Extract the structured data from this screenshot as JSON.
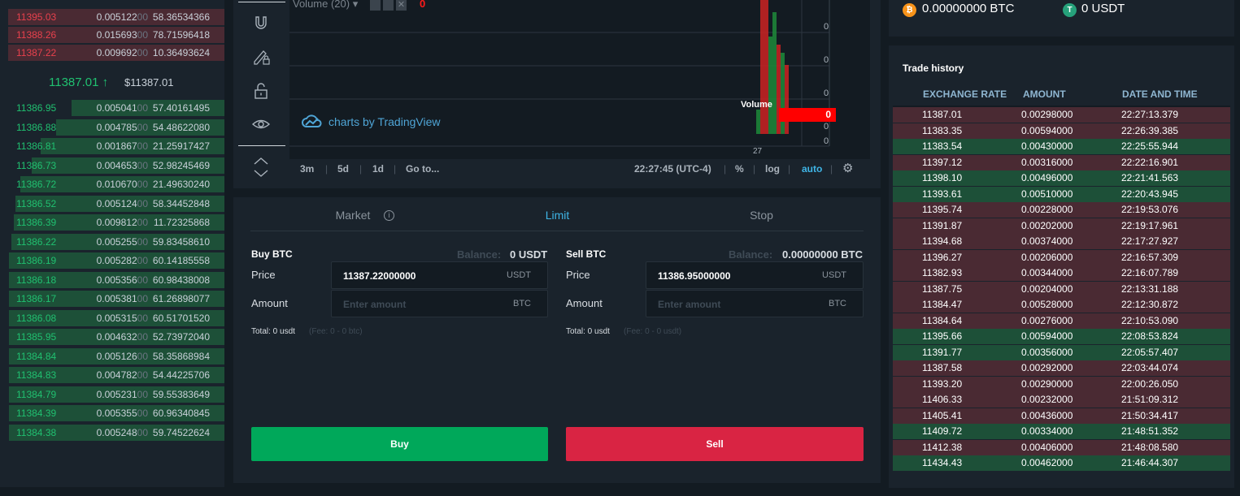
{
  "orderbook": {
    "asks": [
      {
        "price": "11395.03",
        "amount": "0.005122",
        "amount_dim": "00",
        "total": "58.36534366"
      },
      {
        "price": "11388.26",
        "amount": "0.015693",
        "amount_dim": "00",
        "total": "78.71596418"
      },
      {
        "price": "11387.22",
        "amount": "0.009692",
        "amount_dim": "00",
        "total": "10.36493624"
      }
    ],
    "last_price": "11387.01",
    "last_arrow": "↑",
    "last_usd": "$11387.01",
    "bids": [
      {
        "price": "11386.95",
        "amount": "0.005041",
        "amount_dim": "00",
        "total": "57.40161495",
        "depth": 0.68
      },
      {
        "price": "11386.88",
        "amount": "0.004785",
        "amount_dim": "00",
        "total": "54.48622080",
        "depth": 0.75
      },
      {
        "price": "11386.81",
        "amount": "0.001867",
        "amount_dim": "00",
        "total": "21.25917427",
        "depth": 0.82
      },
      {
        "price": "11386.73",
        "amount": "0.004653",
        "amount_dim": "00",
        "total": "52.98245469",
        "depth": 0.86
      },
      {
        "price": "11386.72",
        "amount": "0.010670",
        "amount_dim": "00",
        "total": "21.49630240",
        "depth": 0.91
      },
      {
        "price": "11386.52",
        "amount": "0.005124",
        "amount_dim": "00",
        "total": "58.34452848",
        "depth": 0.93
      },
      {
        "price": "11386.39",
        "amount": "0.009812",
        "amount_dim": "00",
        "total": "11.72325868",
        "depth": 0.94
      },
      {
        "price": "11386.22",
        "amount": "0.005255",
        "amount_dim": "00",
        "total": "59.83458610",
        "depth": 0.95
      },
      {
        "price": "11386.19",
        "amount": "0.005282",
        "amount_dim": "00",
        "total": "60.14185558",
        "depth": 0.96
      },
      {
        "price": "11386.18",
        "amount": "0.005356",
        "amount_dim": "00",
        "total": "60.98438008",
        "depth": 0.96
      },
      {
        "price": "11386.17",
        "amount": "0.005381",
        "amount_dim": "00",
        "total": "61.26898077",
        "depth": 0.96
      },
      {
        "price": "11386.08",
        "amount": "0.005315",
        "amount_dim": "00",
        "total": "60.51701520",
        "depth": 0.96
      },
      {
        "price": "11385.95",
        "amount": "0.004632",
        "amount_dim": "00",
        "total": "52.73972040",
        "depth": 0.96
      },
      {
        "price": "11384.84",
        "amount": "0.005126",
        "amount_dim": "00",
        "total": "58.35868984",
        "depth": 0.96
      },
      {
        "price": "11384.83",
        "amount": "0.004782",
        "amount_dim": "00",
        "total": "54.44225706",
        "depth": 0.96
      },
      {
        "price": "11384.79",
        "amount": "0.005231",
        "amount_dim": "00",
        "total": "59.55383649",
        "depth": 0.96
      },
      {
        "price": "11384.39",
        "amount": "0.005355",
        "amount_dim": "00",
        "total": "60.96340845",
        "depth": 0.96
      },
      {
        "price": "11384.38",
        "amount": "0.005248",
        "amount_dim": "00",
        "total": "59.74522624",
        "depth": 0.96
      }
    ]
  },
  "chart": {
    "volume_label": "Volume (20)",
    "volume_value": "0",
    "axis_labels": [
      "0",
      "0",
      "0",
      "0",
      "0"
    ],
    "volume_tag": "Volume",
    "volume_tag_value": "0",
    "watermark": "charts by TradingView",
    "date_tick": "27",
    "toolbar": {
      "r3m": "3m",
      "r5d": "5d",
      "r1d": "1d",
      "goto": "Go to...",
      "time": "22:27:45 (UTC-4)",
      "pct": "%",
      "log": "log",
      "auto": "auto"
    }
  },
  "trade": {
    "tabs": {
      "market": "Market",
      "limit": "Limit",
      "stop": "Stop"
    },
    "buy": {
      "title": "Buy BTC",
      "balance_label": "Balance:",
      "balance_value": "0 USDT",
      "price_label": "Price",
      "price_value": "11387.22000000",
      "price_unit": "USDT",
      "amount_label": "Amount",
      "amount_placeholder": "Enter amount",
      "amount_unit": "BTC",
      "total": "Total: 0 usdt",
      "fee": "(Fee: 0 - 0 btc)",
      "button": "Buy"
    },
    "sell": {
      "title": "Sell BTC",
      "balance_label": "Balance:",
      "balance_value": "0.00000000 BTC",
      "price_label": "Price",
      "price_value": "11386.95000000",
      "price_unit": "USDT",
      "amount_label": "Amount",
      "amount_placeholder": "Enter amount",
      "amount_unit": "BTC",
      "total": "Total: 0 usdt",
      "fee": "(Fee: 0 - 0 usdt)",
      "button": "Sell"
    }
  },
  "balances": {
    "btc": "0.00000000  BTC",
    "usdt": "0  USDT",
    "btc_color": "#f7931a",
    "usdt_color": "#26a17b"
  },
  "history": {
    "title": "Trade history",
    "headers": {
      "rate": "EXCHANGE RATE",
      "amount": "AMOUNT",
      "time": "DATE AND TIME"
    },
    "rows": [
      {
        "side": "sell",
        "rate": "11387.01",
        "amount": "0.00298000",
        "time": "22:27:13.379"
      },
      {
        "side": "sell",
        "rate": "11383.35",
        "amount": "0.00594000",
        "time": "22:26:39.385"
      },
      {
        "side": "buy",
        "rate": "11383.54",
        "amount": "0.00430000",
        "time": "22:25:55.944"
      },
      {
        "side": "sell",
        "rate": "11397.12",
        "amount": "0.00316000",
        "time": "22:22:16.901"
      },
      {
        "side": "buy",
        "rate": "11398.10",
        "amount": "0.00496000",
        "time": "22:21:41.563"
      },
      {
        "side": "buy",
        "rate": "11393.61",
        "amount": "0.00510000",
        "time": "22:20:43.945"
      },
      {
        "side": "sell",
        "rate": "11395.74",
        "amount": "0.00228000",
        "time": "22:19:53.076"
      },
      {
        "side": "sell",
        "rate": "11391.87",
        "amount": "0.00202000",
        "time": "22:19:17.961"
      },
      {
        "side": "sell",
        "rate": "11394.68",
        "amount": "0.00374000",
        "time": "22:17:27.927"
      },
      {
        "side": "sell",
        "rate": "11396.27",
        "amount": "0.00206000",
        "time": "22:16:57.309"
      },
      {
        "side": "sell",
        "rate": "11382.93",
        "amount": "0.00344000",
        "time": "22:16:07.789"
      },
      {
        "side": "sell",
        "rate": "11387.75",
        "amount": "0.00204000",
        "time": "22:13:31.188"
      },
      {
        "side": "sell",
        "rate": "11384.47",
        "amount": "0.00528000",
        "time": "22:12:30.872"
      },
      {
        "side": "sell",
        "rate": "11384.64",
        "amount": "0.00276000",
        "time": "22:10:53.090"
      },
      {
        "side": "buy",
        "rate": "11395.66",
        "amount": "0.00594000",
        "time": "22:08:53.824"
      },
      {
        "side": "buy",
        "rate": "11391.77",
        "amount": "0.00356000",
        "time": "22:05:57.407"
      },
      {
        "side": "sell",
        "rate": "11387.58",
        "amount": "0.00292000",
        "time": "22:03:44.074"
      },
      {
        "side": "sell",
        "rate": "11393.20",
        "amount": "0.00290000",
        "time": "22:00:26.050"
      },
      {
        "side": "sell",
        "rate": "11406.33",
        "amount": "0.00232000",
        "time": "21:51:09.312"
      },
      {
        "side": "sell",
        "rate": "11405.41",
        "amount": "0.00436000",
        "time": "21:50:34.417"
      },
      {
        "side": "buy",
        "rate": "11409.72",
        "amount": "0.00334000",
        "time": "21:48:51.352"
      },
      {
        "side": "sell",
        "rate": "11412.38",
        "amount": "0.00406000",
        "time": "21:48:08.580"
      },
      {
        "side": "buy",
        "rate": "11434.43",
        "amount": "0.00462000",
        "time": "21:46:44.307"
      }
    ]
  }
}
